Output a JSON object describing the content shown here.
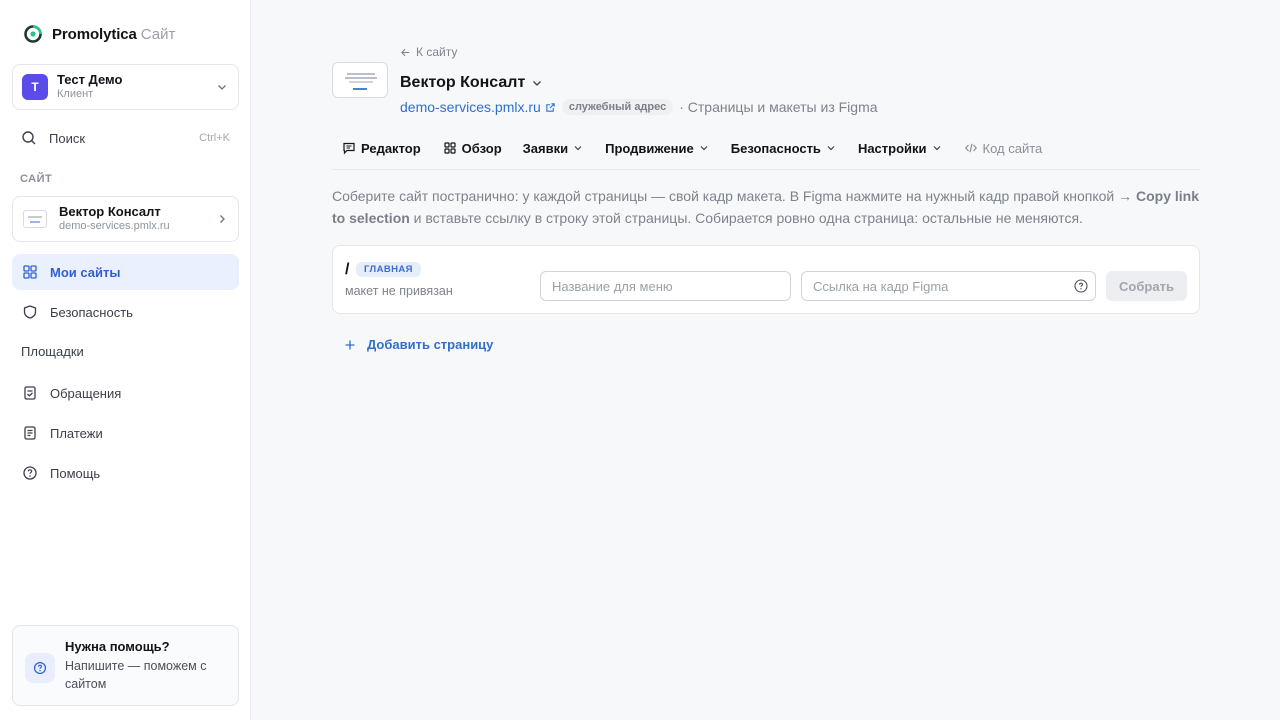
{
  "brand": {
    "name": "Promolytica",
    "sub": "Сайт"
  },
  "account": {
    "initial": "Т",
    "name": "Тест Демо",
    "role": "Клиент"
  },
  "search": {
    "label": "Поиск",
    "shortcut": "Ctrl+K"
  },
  "sidebar": {
    "section_label": "САЙТ",
    "site": {
      "name": "Вектор Консалт",
      "domain": "demo-services.pmlx.ru"
    },
    "items": [
      {
        "label": "Мои сайты"
      },
      {
        "label": "Безопасность"
      },
      {
        "label": "Площадки"
      },
      {
        "label": "Обращения"
      },
      {
        "label": "Платежи"
      },
      {
        "label": "Помощь"
      }
    ],
    "help": {
      "title": "Нужна помощь?",
      "text": "Напишите — поможем с сайтом"
    }
  },
  "header": {
    "back_label": "К сайту",
    "site_title": "Вектор Консалт",
    "domain": "demo-services.pmlx.ru",
    "domain_badge": "служебный адрес",
    "meta": "· Страницы и макеты из Figma"
  },
  "tabs": [
    {
      "label": "Редактор"
    },
    {
      "label": "Обзор"
    },
    {
      "label": "Заявки"
    },
    {
      "label": "Продвижение"
    },
    {
      "label": "Безопасность"
    },
    {
      "label": "Настройки"
    },
    {
      "label": "Код сайта"
    }
  ],
  "intro": {
    "part1": "Соберите сайт постранично: у каждой страницы — свой кадр макета. В Figma нажмите на нужный кадр правой кнопкой → ",
    "bold": "Copy link to selection",
    "part2": " и вставьте ссылку в строку этой страницы. Собирается ровно одна страница: остальные не меняются."
  },
  "page_row": {
    "path": "/",
    "badge": "ГЛАВНАЯ",
    "status": "макет не привязан",
    "name_placeholder": "Название для меню",
    "link_placeholder": "Ссылка на кадр Figma",
    "build_label": "Собрать"
  },
  "add_page_label": "Добавить страницу",
  "colors": {
    "accent": "#2f6fd1",
    "active_bg": "#eaf0fd",
    "avatar": "#5b4be8"
  }
}
